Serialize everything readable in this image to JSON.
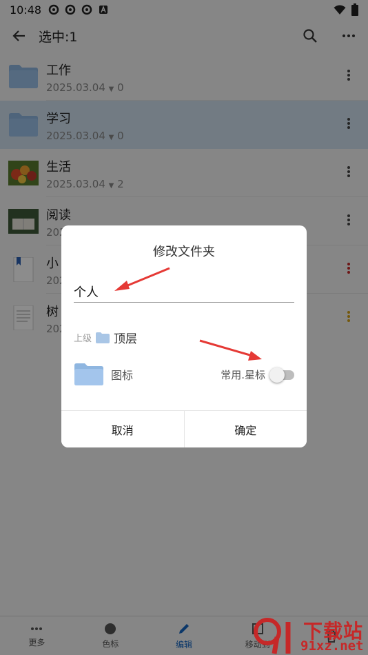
{
  "status_bar": {
    "time": "10:48"
  },
  "app_bar": {
    "title": "选中:1"
  },
  "files": [
    {
      "name": "工作",
      "date": "2025.03.04",
      "count": "0",
      "thumb": "folder-icon"
    },
    {
      "name": "学习",
      "date": "2025.03.04",
      "count": "0",
      "thumb": "folder-icon",
      "selected": true
    },
    {
      "name": "生活",
      "date": "2025.03.04",
      "count": "2",
      "thumb": "fruit-photo"
    },
    {
      "name": "阅读",
      "date": "202",
      "count": "",
      "thumb": "reading-photo"
    },
    {
      "name": "小",
      "date": "202",
      "count": "",
      "thumb": "bookmark-doc-icon"
    },
    {
      "name": "树",
      "date": "202",
      "count": "",
      "thumb": "document-icon"
    }
  ],
  "dialog": {
    "title": "修改文件夹",
    "name_value": "个人",
    "parent_label": "上级",
    "parent_value": "顶层",
    "icon_label": "图标",
    "star_label": "常用.星标",
    "star_enabled": false,
    "cancel": "取消",
    "confirm": "确定"
  },
  "bottom_nav": [
    {
      "label": "更多",
      "icon": "more-dots-icon"
    },
    {
      "label": "色标",
      "icon": "color-dot-icon"
    },
    {
      "label": "编辑",
      "icon": "pencil-icon",
      "active": true
    },
    {
      "label": "移动到",
      "icon": "move-icon"
    },
    {
      "label": "",
      "icon": "trash-icon"
    }
  ],
  "watermark": {
    "text": "下载站",
    "domain": "91xz.net"
  },
  "colors": {
    "accent": "#1565c0",
    "selected_row": "#cfe0ee",
    "arrow": "#e53935",
    "folder": "#8fb6e0"
  }
}
